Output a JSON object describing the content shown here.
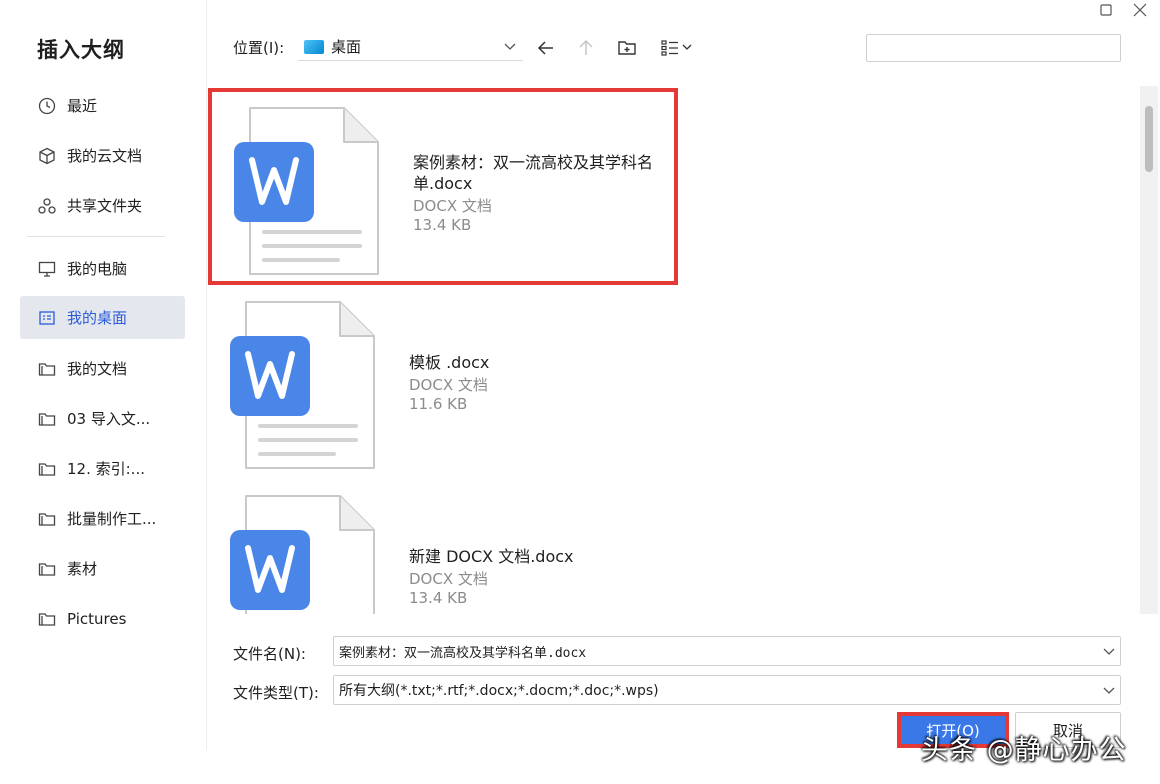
{
  "window": {
    "maximize_icon": "maximize-icon",
    "close_icon": "close-icon"
  },
  "sidebar": {
    "title": "插入大纲",
    "items": [
      {
        "label": "最近",
        "icon": "clock-icon"
      },
      {
        "label": "我的云文档",
        "icon": "cube-icon"
      },
      {
        "label": "共享文件夹",
        "icon": "share-icon"
      },
      {
        "label": "我的电脑",
        "icon": "monitor-icon"
      },
      {
        "label": "我的桌面",
        "icon": "desktop-icon",
        "active": true
      },
      {
        "label": "我的文档",
        "icon": "folder-icon"
      },
      {
        "label": "03 导入文...",
        "icon": "folder-icon"
      },
      {
        "label": "12. 索引:...",
        "icon": "folder-icon"
      },
      {
        "label": "批量制作工...",
        "icon": "folder-icon"
      },
      {
        "label": "素材",
        "icon": "folder-icon"
      },
      {
        "label": "Pictures",
        "icon": "folder-icon"
      }
    ]
  },
  "toolbar": {
    "location_label": "位置(I):",
    "location_value": "桌面",
    "search_placeholder": ""
  },
  "files": [
    {
      "name": "案例素材：双一流高校及其学科名单.docx",
      "type": "DOCX 文档",
      "size": "13.4 KB",
      "selected": true
    },
    {
      "name": "模板 .docx",
      "type": "DOCX 文档",
      "size": "11.6 KB",
      "selected": false
    },
    {
      "name": "新建 DOCX 文档.docx",
      "type": "DOCX 文档",
      "size": "13.4 KB",
      "selected": false
    }
  ],
  "form": {
    "filename_label": "文件名(N):",
    "filename_value": "案例素材：双一流高校及其学科名单.docx",
    "filetype_label": "文件类型(T):",
    "filetype_value": "所有大纲(*.txt;*.rtf;*.docx;*.docm;*.doc;*.wps)"
  },
  "buttons": {
    "open": "打开(O)",
    "cancel": "取消"
  },
  "watermark": "头条 @静心办公",
  "colors": {
    "accent": "#3a78e8",
    "highlight_red": "#e53935",
    "word_blue": "#4a86e8"
  }
}
